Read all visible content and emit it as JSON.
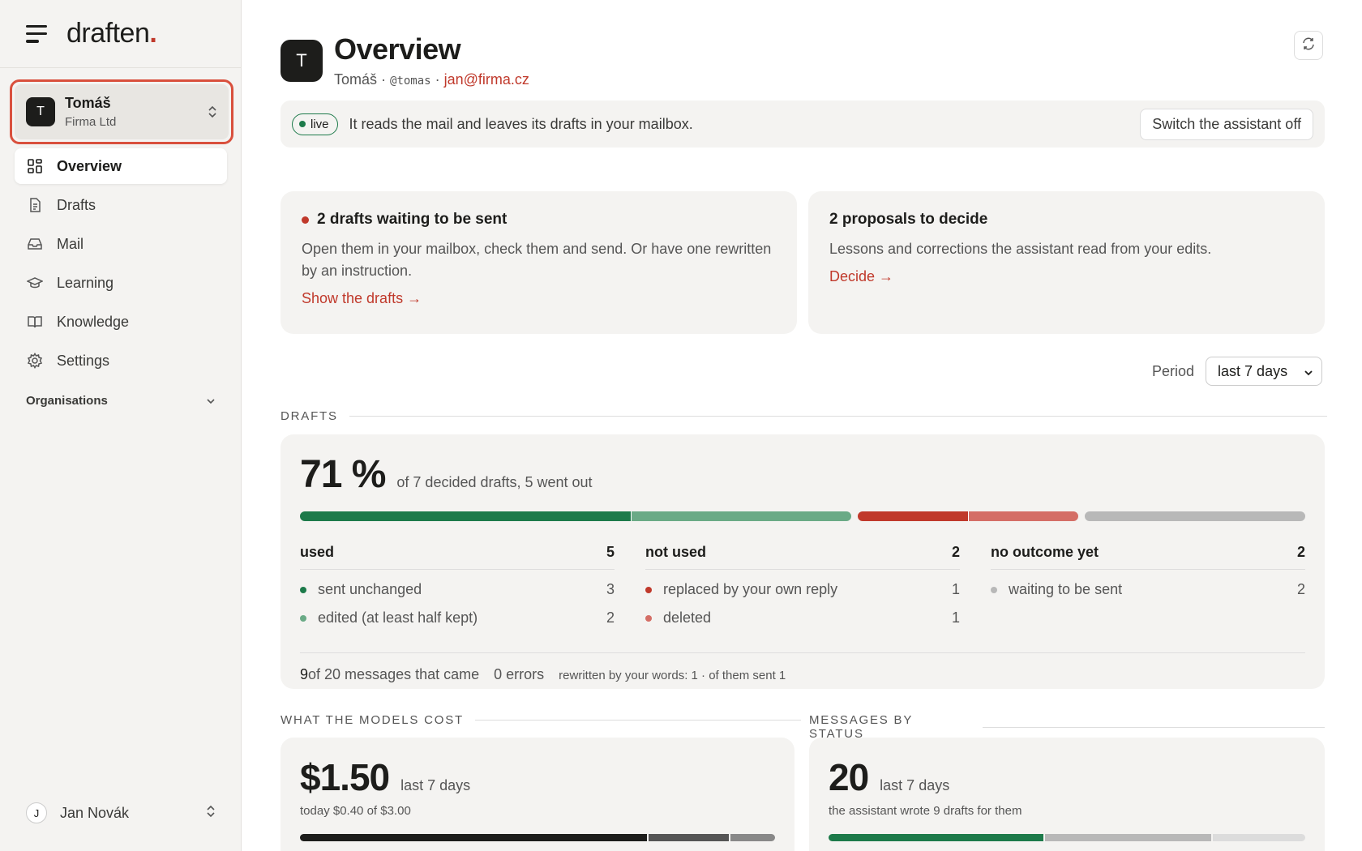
{
  "brand": {
    "name": "draften",
    "dot": "."
  },
  "account": {
    "initial": "T",
    "name": "Tomáš",
    "org": "Firma Ltd"
  },
  "nav": [
    {
      "label": "Overview",
      "icon": "grid-icon",
      "active": true
    },
    {
      "label": "Drafts",
      "icon": "document-icon"
    },
    {
      "label": "Mail",
      "icon": "inbox-icon"
    },
    {
      "label": "Learning",
      "icon": "graduation-cap-icon"
    },
    {
      "label": "Knowledge",
      "icon": "book-icon"
    },
    {
      "label": "Settings",
      "icon": "gear-icon"
    }
  ],
  "organisations_label": "Organisations",
  "user": {
    "initial": "J",
    "name": "Jan Novák"
  },
  "header": {
    "initial": "T",
    "title": "Overview",
    "name": "Tomáš",
    "sep1": " · ",
    "handle": "@tomas",
    "sep2": " · ",
    "email": "jan@firma.cz"
  },
  "status": {
    "pill": "live",
    "text": "It reads the mail and leaves its drafts in your mailbox.",
    "button": "Switch the assistant off"
  },
  "card_drafts": {
    "title": "2 drafts waiting to be sent",
    "text": "Open them in your mailbox, check them and send. Or have one rewritten by an instruction.",
    "link": "Show the drafts →"
  },
  "card_proposals": {
    "title": "2 proposals to decide",
    "text": "Lessons and corrections the assistant read from your edits.",
    "link": "Decide →"
  },
  "period": {
    "label": "Period",
    "value": "last 7 days"
  },
  "drafts_section": {
    "label": "DRAFTS",
    "percent": "71 %",
    "percent_sub": "of 7 decided drafts, 5 went out",
    "columns": [
      {
        "head": "used",
        "count": "5",
        "items": [
          {
            "label": "sent unchanged",
            "count": "3",
            "color": "#1d7a4a"
          },
          {
            "label": "edited (at least half kept)",
            "count": "2",
            "color": "#6aaa86"
          }
        ]
      },
      {
        "head": "not used",
        "count": "2",
        "items": [
          {
            "label": "replaced by your own reply",
            "count": "1",
            "color": "#c0392b"
          },
          {
            "label": "deleted",
            "count": "1",
            "color": "#d46e66"
          }
        ]
      },
      {
        "head": "no outcome yet",
        "count": "2",
        "items": [
          {
            "label": "waiting to be sent",
            "count": "2",
            "color": "#b8b8b8"
          }
        ]
      }
    ],
    "foot_num": "9",
    "foot_text": " of 20 messages that came",
    "foot_errors": "0 errors",
    "foot_rewritten": "rewritten by your words: 1 · of them sent 1"
  },
  "cost_section": {
    "label": "WHAT THE MODELS COST",
    "amount": "$1.50",
    "period": "last 7 days",
    "today": "today $0.40 of $3.00",
    "bar": [
      0.73,
      0.17,
      0.1
    ]
  },
  "status_section": {
    "label": "MESSAGES BY STATUS",
    "count": "20",
    "period": "last 7 days",
    "sub": "the assistant wrote 9 drafts for them",
    "bar": [
      0.45,
      0.35,
      0.2
    ]
  },
  "colors": {
    "accent": "#c0392b",
    "green": "#1d7a4a",
    "green_light": "#6aaa86",
    "red": "#c0392b",
    "red_light": "#d46e66",
    "grey": "#b8b8b8"
  }
}
